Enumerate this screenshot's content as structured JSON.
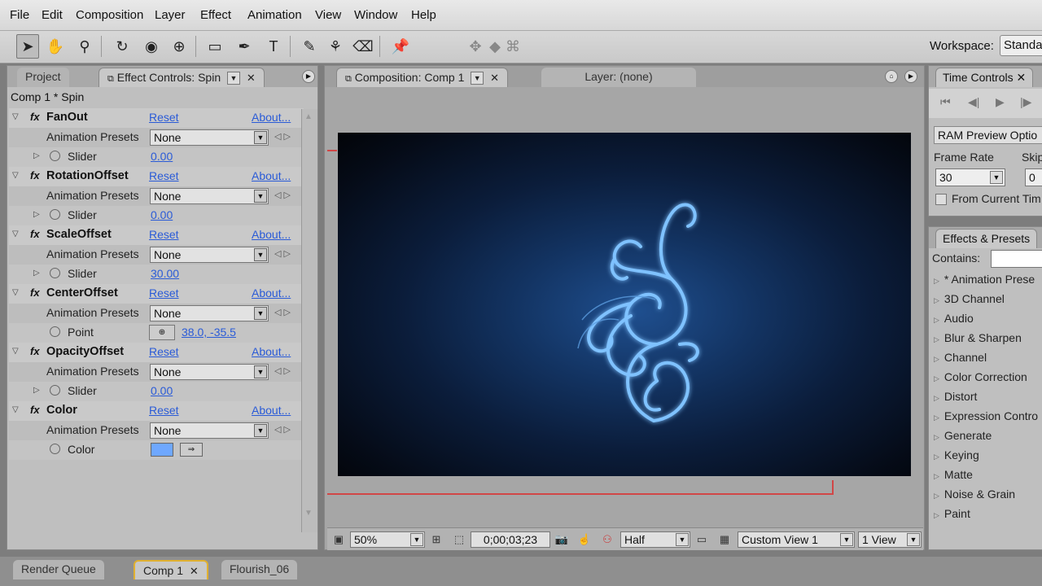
{
  "menu": [
    "File",
    "Edit",
    "Composition",
    "Layer",
    "Effect",
    "Animation",
    "View",
    "Window",
    "Help"
  ],
  "toolbar": {
    "workspace_label": "Workspace:",
    "workspace_value": "Standa"
  },
  "left_panel": {
    "tab_project": "Project",
    "tab_effect_controls": "Effect Controls: Spin",
    "header": "Comp 1 * Spin",
    "effects": [
      {
        "name": "FanOut",
        "reset": "Reset",
        "about": "About...",
        "presets_label": "Animation Presets",
        "presets_value": "None",
        "prop_label": "Slider",
        "prop_value": "0.00"
      },
      {
        "name": "RotationOffset",
        "reset": "Reset",
        "about": "About...",
        "presets_label": "Animation Presets",
        "presets_value": "None",
        "prop_label": "Slider",
        "prop_value": "0.00"
      },
      {
        "name": "ScaleOffset",
        "reset": "Reset",
        "about": "About...",
        "presets_label": "Animation Presets",
        "presets_value": "None",
        "prop_label": "Slider",
        "prop_value": "30.00"
      },
      {
        "name": "CenterOffset",
        "reset": "Reset",
        "about": "About...",
        "presets_label": "Animation Presets",
        "presets_value": "None",
        "prop_label": "Point",
        "prop_value": "38.0, -35.5"
      },
      {
        "name": "OpacityOffset",
        "reset": "Reset",
        "about": "About...",
        "presets_label": "Animation Presets",
        "presets_value": "None",
        "prop_label": "Slider",
        "prop_value": "0.00"
      },
      {
        "name": "Color",
        "reset": "Reset",
        "about": "About...",
        "presets_label": "Animation Presets",
        "presets_value": "None",
        "prop_label": "Color",
        "prop_value": ""
      }
    ],
    "color_swatch": "#6fa8ff"
  },
  "comp_panel": {
    "tab_composition": "Composition: Comp 1",
    "tab_layer": "Layer: (none)",
    "zoom": "50%",
    "timecode": "0;00;03;23",
    "resolution": "Half",
    "view": "Custom View 1",
    "views": "1 View"
  },
  "time_controls": {
    "tab": "Time Controls",
    "ram_preview": "RAM Preview Optio",
    "frame_rate_label": "Frame Rate",
    "skip_label": "Skip",
    "frame_rate_value": "30",
    "skip_value": "0",
    "from_current": "From Current Tim"
  },
  "effects_presets": {
    "tab": "Effects & Presets",
    "contains_label": "Contains:",
    "items": [
      "* Animation Prese",
      "3D Channel",
      "Audio",
      "Blur & Sharpen",
      "Channel",
      "Color Correction",
      "Distort",
      "Expression Contro",
      "Generate",
      "Keying",
      "Matte",
      "Noise & Grain",
      "Paint"
    ]
  },
  "bottom_tabs": [
    "Render Queue",
    "Comp 1",
    "Flourish_06"
  ]
}
